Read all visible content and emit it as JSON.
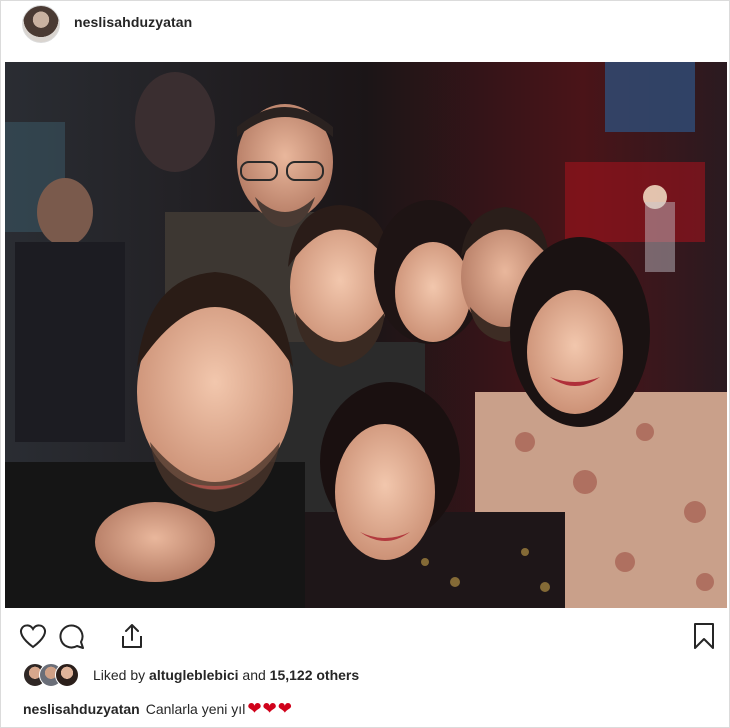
{
  "post": {
    "username": "neslisahduzyatan",
    "avatar_icon": "profile-avatar",
    "photo_icon": "group-selfie-photo"
  },
  "actions": {
    "like_icon": "heart-outline-icon",
    "comment_icon": "comment-bubble-icon",
    "share_icon": "share-upload-icon",
    "save_icon": "bookmark-icon"
  },
  "likes": {
    "prefix": "Liked by",
    "liked_user": "altugleblebici",
    "connector": "and",
    "others": "15,122 others"
  },
  "caption": {
    "username": "neslisahduzyatan",
    "text": "Canlarla yeni yıl",
    "emoji": "❤❤❤"
  },
  "colors": {
    "text": "#262626",
    "border": "#dbdbdb",
    "heart_red": "#d0021b"
  }
}
